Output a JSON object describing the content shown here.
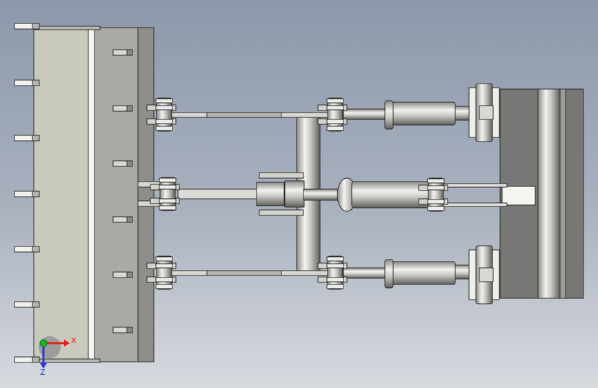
{
  "triad": {
    "x_label": "X",
    "z_label": "Z",
    "x_color": "#e0201c",
    "y_color": "#18b81e",
    "z_color": "#2a3ad0"
  },
  "palette": {
    "background_top": "#8c98aa",
    "background_bottom": "#d7dadf",
    "metal_light": "#e6e6e2",
    "metal_mid": "#bdbdb8",
    "metal_dark": "#6f6f6c",
    "bucket_face": "#c9c9bd",
    "outline": "#2b2b2b"
  }
}
